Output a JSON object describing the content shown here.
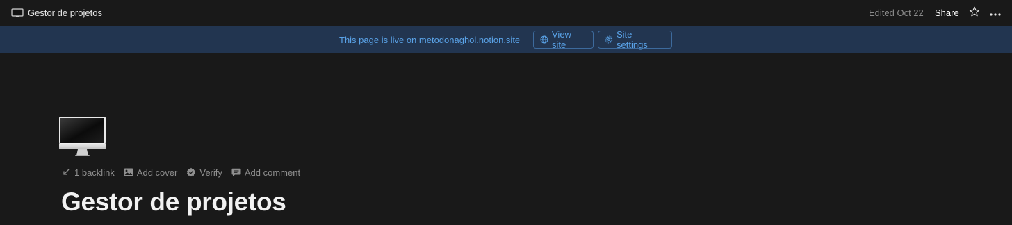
{
  "topbar": {
    "breadcrumb": {
      "icon": "desktop-computer-icon",
      "label": "Gestor de projetos"
    },
    "edited": "Edited Oct 22",
    "share_label": "Share",
    "favorite_icon": "star-icon",
    "more_icon": "more-horizontal-icon"
  },
  "banner": {
    "text": "This page is live on metodonaghol.notion.site",
    "view_site": {
      "icon": "globe-icon",
      "label": "View site"
    },
    "site_settings": {
      "icon": "gear-icon",
      "label": "Site settings"
    }
  },
  "page": {
    "icon": "desktop-computer-icon",
    "meta": {
      "backlink": {
        "icon": "arrow-down-left-icon",
        "label": "1 backlink"
      },
      "add_cover": {
        "icon": "image-icon",
        "label": "Add cover"
      },
      "verify": {
        "icon": "verified-badge-icon",
        "label": "Verify"
      },
      "add_comment": {
        "icon": "comment-icon",
        "label": "Add comment"
      }
    },
    "title": "Gestor de projetos"
  },
  "colors": {
    "background": "#191919",
    "banner_background": "#223550",
    "banner_accent": "#5aa3e8"
  }
}
